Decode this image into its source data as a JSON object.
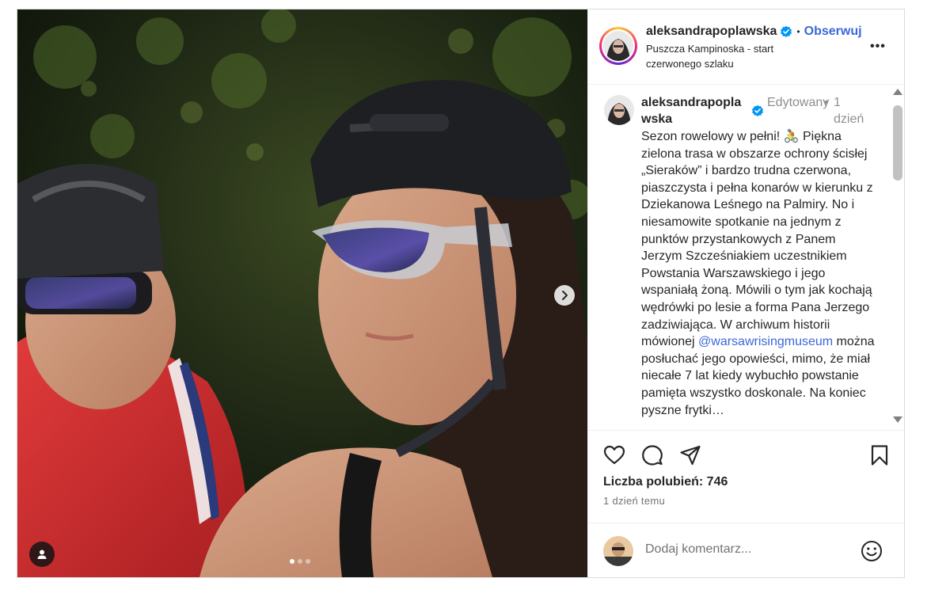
{
  "post": {
    "photo": {
      "alt": "Zdjęcie rowerzystów w kaskach w lesie",
      "next_icon": "chevron-right-icon",
      "tag_icon": "user-tag-icon",
      "carousel_dots": 3,
      "active_dot": 1
    },
    "header": {
      "username": "aleksandrapoplawska",
      "separator": "•",
      "follow_label": "Obserwuj",
      "location": "Puszcza Kampinoska - start czerwonego szlaku",
      "more_label": "•••"
    },
    "caption": {
      "username": "aleksandrapoplawska",
      "edited_label": "Edytowany",
      "dot": "•",
      "time": "1 dzień",
      "text_before": "Sezon rowelowy w pełni! 🚴 Piękna zielona trasa w obszarze ochrony ścisłej „Sieraków” i bardzo trudna czerwona, piaszczysta i pełna konarów w kierunku z Dziekanowa Leśnego na Palmiry. No i niesamowite spotkanie na jednym z punktów przystankowych z Panem Jerzym Szcześniakiem uczestnikiem Powstania Warszawskiego i jego wspaniałą żoną. Mówili o tym jak kochają wędrówki po lesie a forma Pana Jerzego zadziwiająca. W archiwum historii mówionej ",
      "mention": "@warsawrisingmuseum",
      "text_after": " można posłuchać jego opowieści, mimo, że miał niecałe 7 lat kiedy wybuchło powstanie pamięta wszystko doskonale. Na koniec pyszne frytki…"
    },
    "scrollbar": {
      "up_icon": "▲",
      "down_icon": "▼"
    },
    "actions": {
      "like_icon": "heart-icon",
      "comment_icon": "comment-icon",
      "share_icon": "share-icon",
      "save_icon": "bookmark-icon"
    },
    "likes_text": "Liczba polubień: 746",
    "posted_ago": "1 dzień temu",
    "add_comment": {
      "placeholder": "Dodaj komentarz...",
      "emoji_icon": "emoji-smile-icon"
    },
    "colors": {
      "link": "#3b68d8",
      "verified": "#0095f6",
      "border": "#dbdbdb",
      "muted": "#8e8e8e"
    }
  }
}
